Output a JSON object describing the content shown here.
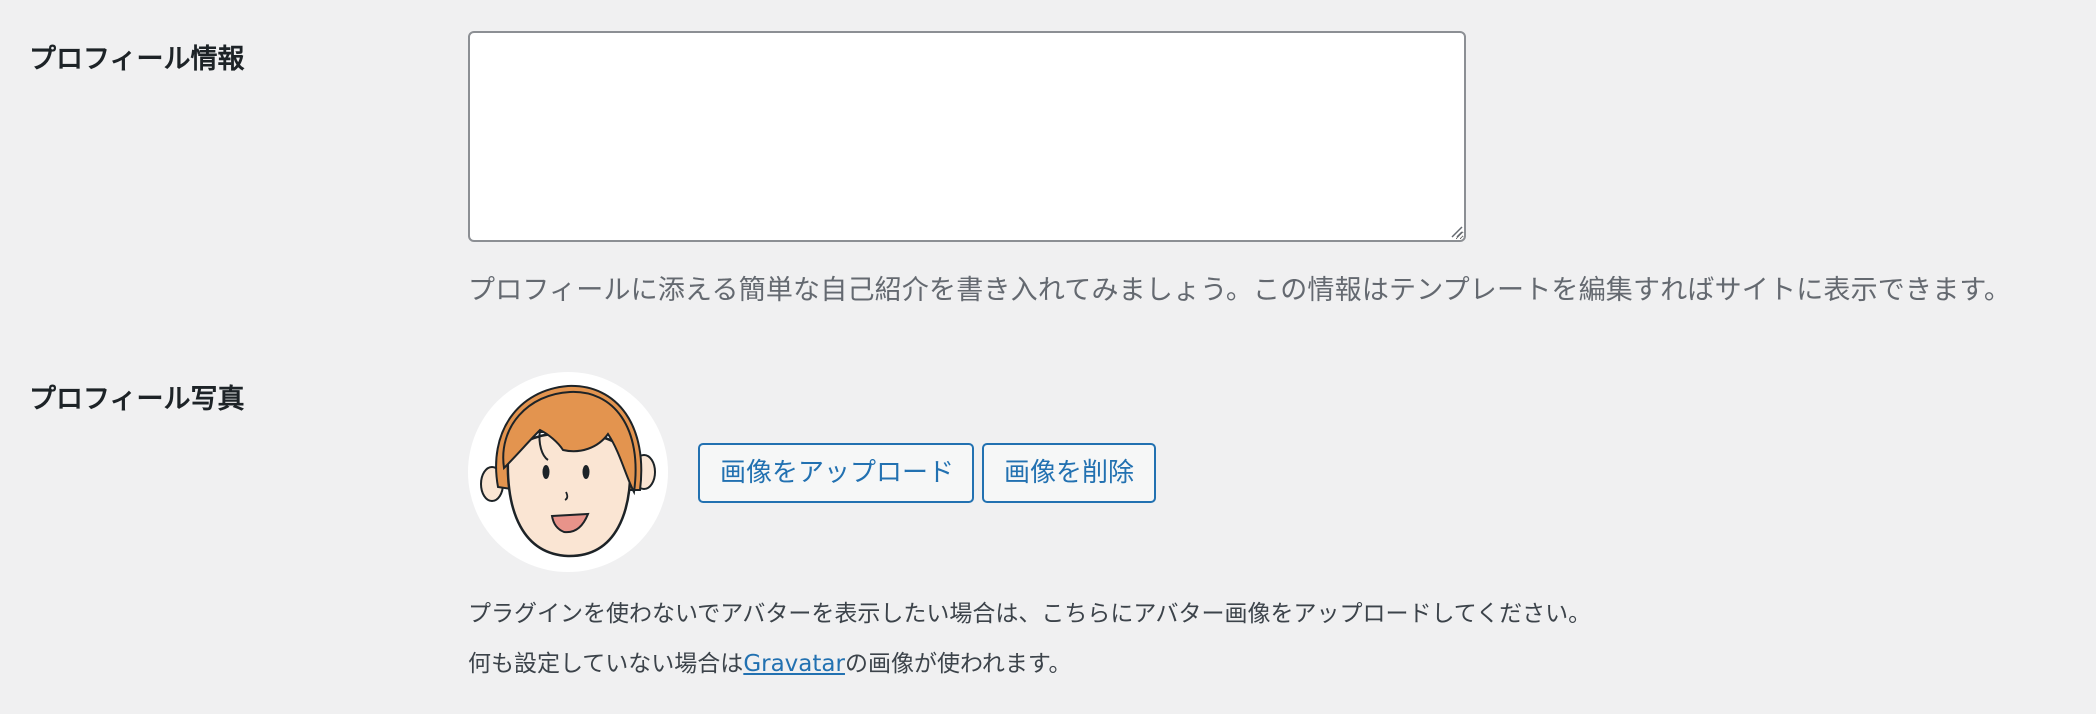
{
  "profile_bio": {
    "label": "プロフィール情報",
    "value": "",
    "description": "プロフィールに添える簡単な自己紹介を書き入れてみましょう。この情報はテンプレートを編集すればサイトに表示できます。"
  },
  "profile_photo": {
    "label": "プロフィール写真",
    "avatar_icon": "cartoon-face-avatar",
    "upload_button_label": "画像をアップロード",
    "delete_button_label": "画像を削除",
    "help_line_1": "プラグインを使わないでアバターを表示したい場合は、こちらにアバター画像をアップロードしてください。",
    "help_line_2_before": "何も設定していない場合は",
    "help_line_2_link": "Gravatar",
    "help_line_2_after": "の画像が使われます。"
  },
  "colors": {
    "page_bg": "#f0f0f1",
    "accent": "#2271b1",
    "hair": "#e3944f",
    "skin": "#fae5d3"
  }
}
